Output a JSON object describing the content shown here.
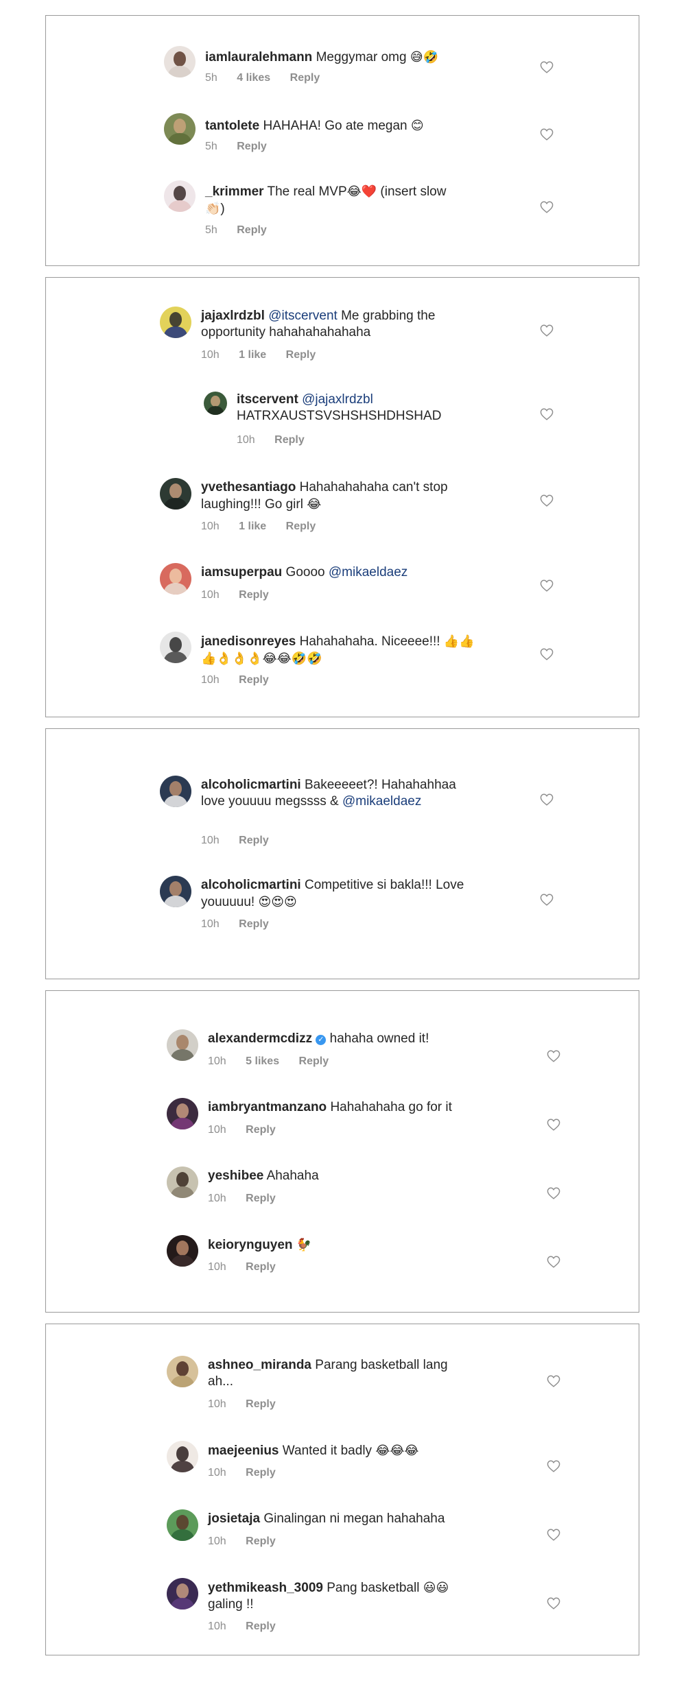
{
  "colors": {
    "border": "#9a9a9a",
    "meta": "#8e8e8e",
    "mention": "#1a3d7a",
    "verified": "#3897f0"
  },
  "panels": [
    {
      "comments": [
        {
          "user": "iamlauralehmann",
          "text": "Meggymar omg",
          "emoji": "😅🤣",
          "time": "5h",
          "likes": "4 likes",
          "reply": "Reply",
          "avatar": "avatar"
        },
        {
          "user": "tantolete",
          "text": "HAHAHA! Go ate megan",
          "emoji": "😊",
          "time": "5h",
          "reply": "Reply",
          "avatar": "avatar"
        },
        {
          "user": "_krimmer",
          "text": "The real MVP",
          "emoji": "😂❤️",
          "text2": "(insert slow",
          "emoji2": "👏🏻",
          "text3": ")",
          "time": "5h",
          "reply": "Reply",
          "avatar": "avatar"
        }
      ]
    },
    {
      "comments": [
        {
          "user": "jajaxlrdzbl",
          "mention": "@itscervent",
          "text": "Me grabbing the opportunity hahahahahahaha",
          "time": "10h",
          "likes": "1 like",
          "reply": "Reply",
          "avatar": "avatar"
        },
        {
          "user": "itscervent",
          "mention": "@jajaxlrdzbl",
          "text": "HATRXAUSTSVSHSHSHDHSHAD",
          "time": "10h",
          "reply": "Reply",
          "avatar": "avatar"
        },
        {
          "user": "yvethesantiago",
          "text": "Hahahahahaha can't stop laughing!!! Go girl",
          "emoji": "😂",
          "time": "10h",
          "likes": "1 like",
          "reply": "Reply",
          "avatar": "avatar"
        },
        {
          "user": "iamsuperpau",
          "text": "Goooo",
          "mention": "@mikaeldaez",
          "time": "10h",
          "reply": "Reply",
          "avatar": "avatar"
        },
        {
          "user": "janedisonreyes",
          "text": "Hahahahaha. Niceeee!!!",
          "emoji": "👍👍👍👌👌👌😂😂🤣🤣",
          "time": "10h",
          "reply": "Reply",
          "avatar": "avatar"
        }
      ]
    },
    {
      "comments": [
        {
          "user": "alcoholicmartini",
          "text": "Bakeeeeet?! Hahahahhaa love youuuu megssss &",
          "mention": "@mikaeldaez",
          "time": "10h",
          "reply": "Reply",
          "avatar": "avatar"
        },
        {
          "user": "alcoholicmartini",
          "text": "Competitive si bakla!!! Love youuuuu!",
          "emoji": "😍😍😍",
          "time": "10h",
          "reply": "Reply",
          "avatar": "avatar"
        }
      ]
    },
    {
      "comments": [
        {
          "user": "alexandermcdizz",
          "verified": "✓",
          "text": "hahaha owned it!",
          "time": "10h",
          "likes": "5 likes",
          "reply": "Reply",
          "avatar": "avatar"
        },
        {
          "user": "iambryantmanzano",
          "text": "Hahahahaha go for it",
          "time": "10h",
          "reply": "Reply",
          "avatar": "avatar"
        },
        {
          "user": "yeshibee",
          "text": "Ahahaha",
          "time": "10h",
          "reply": "Reply",
          "avatar": "avatar"
        },
        {
          "user": "keiorynguyen",
          "emoji": "🐓",
          "time": "10h",
          "reply": "Reply",
          "avatar": "avatar"
        }
      ]
    },
    {
      "comments": [
        {
          "user": "ashneo_miranda",
          "text": "Parang basketball lang ah...",
          "time": "10h",
          "reply": "Reply",
          "avatar": "avatar"
        },
        {
          "user": "maejeenius",
          "text": "Wanted it badly",
          "emoji": "😂😂😂",
          "time": "10h",
          "reply": "Reply",
          "avatar": "avatar"
        },
        {
          "user": "josietaja",
          "text": "Ginalingan ni megan hahahaha",
          "time": "10h",
          "reply": "Reply",
          "avatar": "avatar"
        },
        {
          "user": "yethmikeash_3009",
          "text": "Pang basketball",
          "emoji": "😃😃",
          "text2": "galing !!",
          "time": "10h",
          "reply": "Reply",
          "avatar": "avatar"
        }
      ]
    }
  ],
  "icons": {
    "heart": "heart-outline-icon"
  }
}
